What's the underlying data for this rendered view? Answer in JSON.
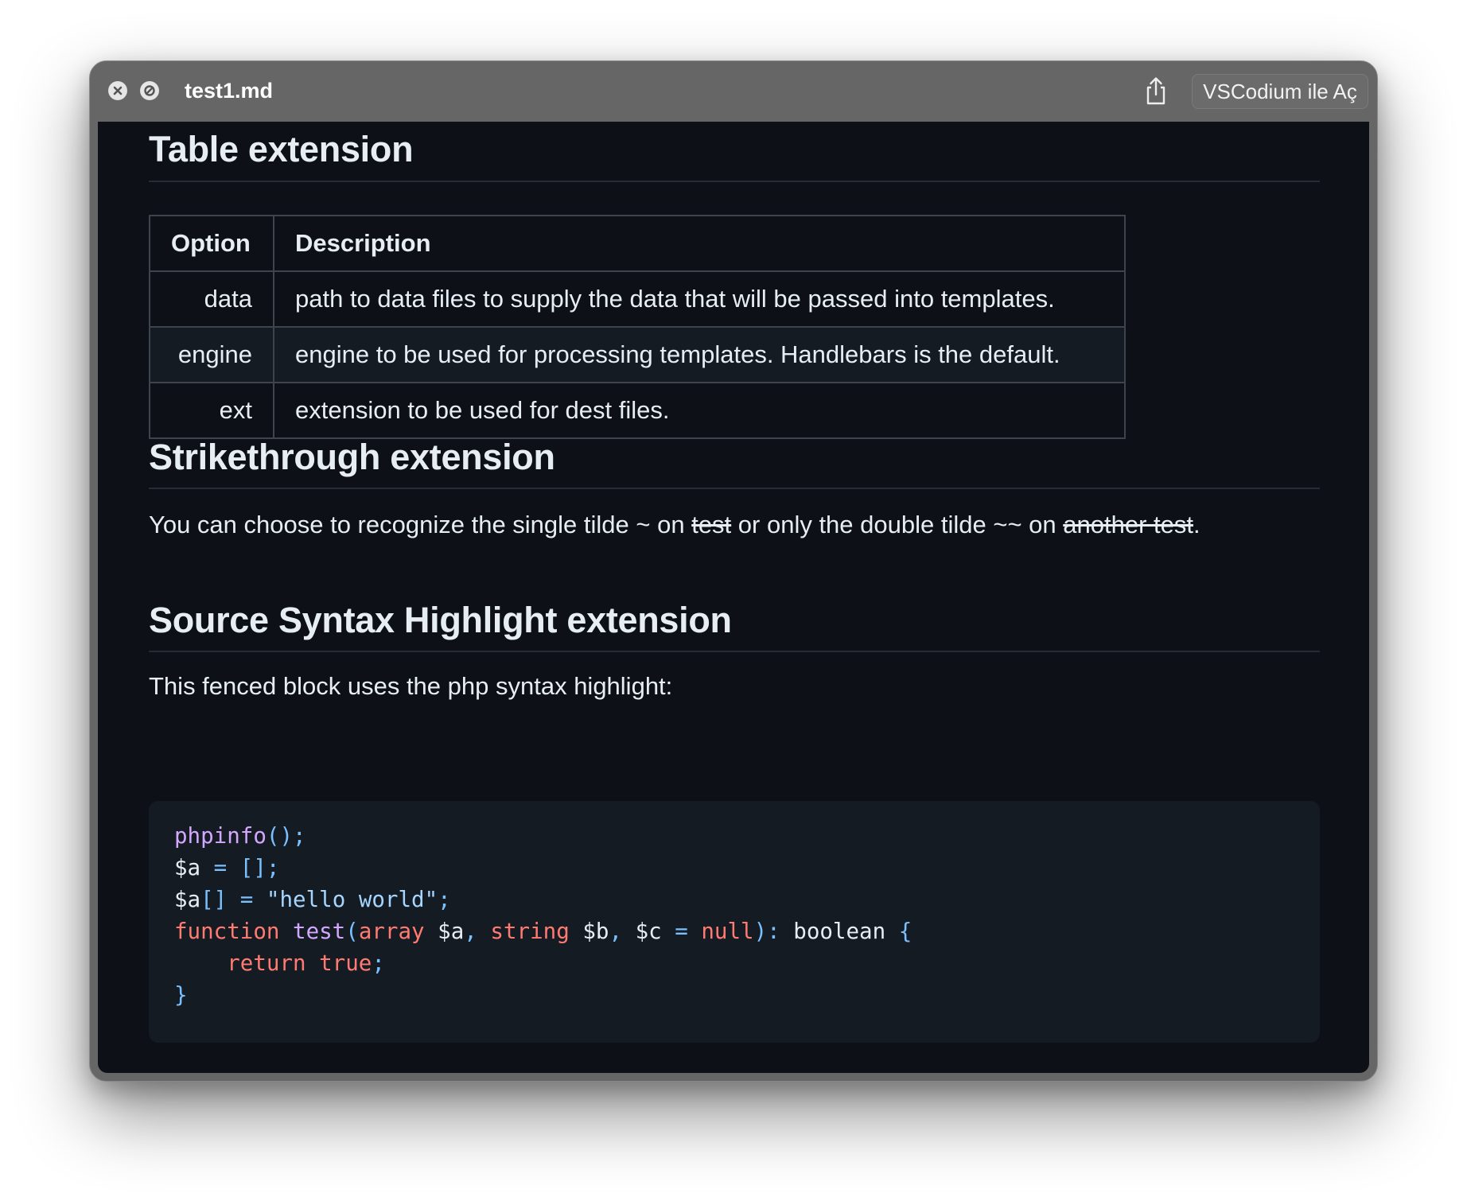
{
  "window": {
    "title": "test1.md",
    "open_button_label": "VSCodium ile Aç",
    "icons": [
      "close-icon",
      "hide-icon",
      "share-icon"
    ]
  },
  "sections": {
    "table": {
      "heading": "Table extension",
      "columns": [
        "Option",
        "Description"
      ],
      "rows": [
        {
          "option": "data",
          "description": "path to data files to supply the data that will be passed into templates."
        },
        {
          "option": "engine",
          "description": "engine to be used for processing templates. Handlebars is the default."
        },
        {
          "option": "ext",
          "description": "extension to be used for dest files."
        }
      ]
    },
    "strikethrough": {
      "heading": "Strikethrough extension",
      "text_1": "You can choose to recognize the single tilde ~ on ",
      "strike_1": "test",
      "text_2": " or only the double tilde ~~ on ",
      "strike_2": "another test",
      "text_3": "."
    },
    "syntax": {
      "heading": "Source Syntax Highlight extension",
      "intro": "This fenced block uses the php syntax highlight:",
      "code_lines": [
        [
          {
            "t": "phpinfo",
            "c": "fn"
          },
          {
            "t": "();",
            "c": "op"
          }
        ],
        [
          {
            "t": "$a ",
            "c": "plain"
          },
          {
            "t": "= [];",
            "c": "op"
          }
        ],
        [
          {
            "t": "$a",
            "c": "plain"
          },
          {
            "t": "[] = ",
            "c": "op"
          },
          {
            "t": "\"hello world\"",
            "c": "str"
          },
          {
            "t": ";",
            "c": "op"
          }
        ],
        [
          {
            "t": "function ",
            "c": "kw"
          },
          {
            "t": "test",
            "c": "fn"
          },
          {
            "t": "(",
            "c": "op"
          },
          {
            "t": "array ",
            "c": "kw"
          },
          {
            "t": "$a",
            "c": "plain"
          },
          {
            "t": ", ",
            "c": "op"
          },
          {
            "t": "string ",
            "c": "kw"
          },
          {
            "t": "$b",
            "c": "plain"
          },
          {
            "t": ", ",
            "c": "op"
          },
          {
            "t": "$c ",
            "c": "plain"
          },
          {
            "t": "= ",
            "c": "op"
          },
          {
            "t": "null",
            "c": "kw"
          },
          {
            "t": "): ",
            "c": "op"
          },
          {
            "t": "boolean ",
            "c": "plain"
          },
          {
            "t": "{",
            "c": "op"
          }
        ],
        [
          {
            "t": "    ",
            "c": "plain"
          },
          {
            "t": "return true",
            "c": "kw"
          },
          {
            "t": ";",
            "c": "op"
          }
        ],
        [
          {
            "t": "}",
            "c": "op"
          }
        ]
      ]
    }
  },
  "colors": {
    "background": "#0d1117",
    "text": "#e6edf3",
    "code_function": "#d2a8ff",
    "code_keyword": "#ff7b72",
    "code_operator": "#79c0ff",
    "code_string": "#a5d6ff"
  }
}
